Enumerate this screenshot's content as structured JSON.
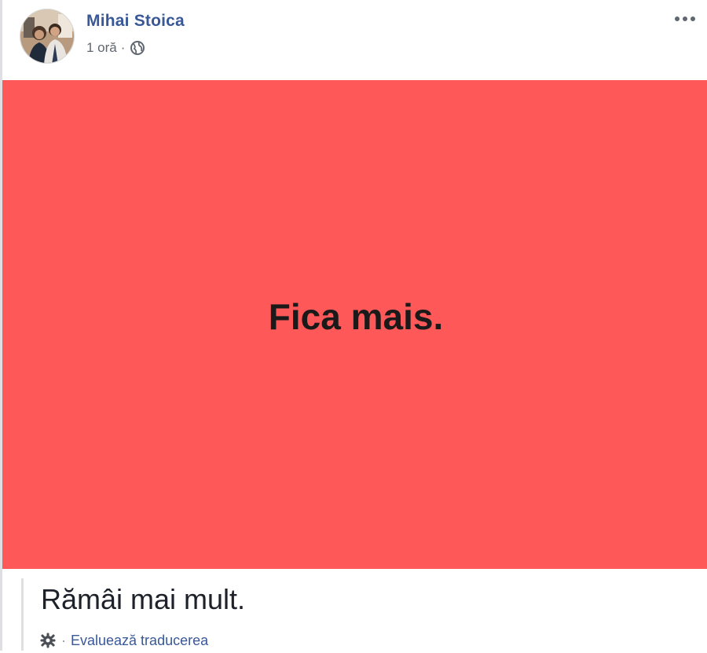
{
  "post": {
    "author": "Mihai Stoica",
    "time": "1 oră",
    "separator": "·",
    "privacy_icon": "globe-icon",
    "more_icon": "ellipsis-icon"
  },
  "media": {
    "text": "Fica mais.",
    "background_color": "#ff5858"
  },
  "translation": {
    "text": "Rămâi mai mult.",
    "separator": "·",
    "settings_icon": "gear-icon",
    "rate_label": "Evaluează traducerea"
  },
  "colors": {
    "link": "#385898",
    "meta": "#616770"
  }
}
